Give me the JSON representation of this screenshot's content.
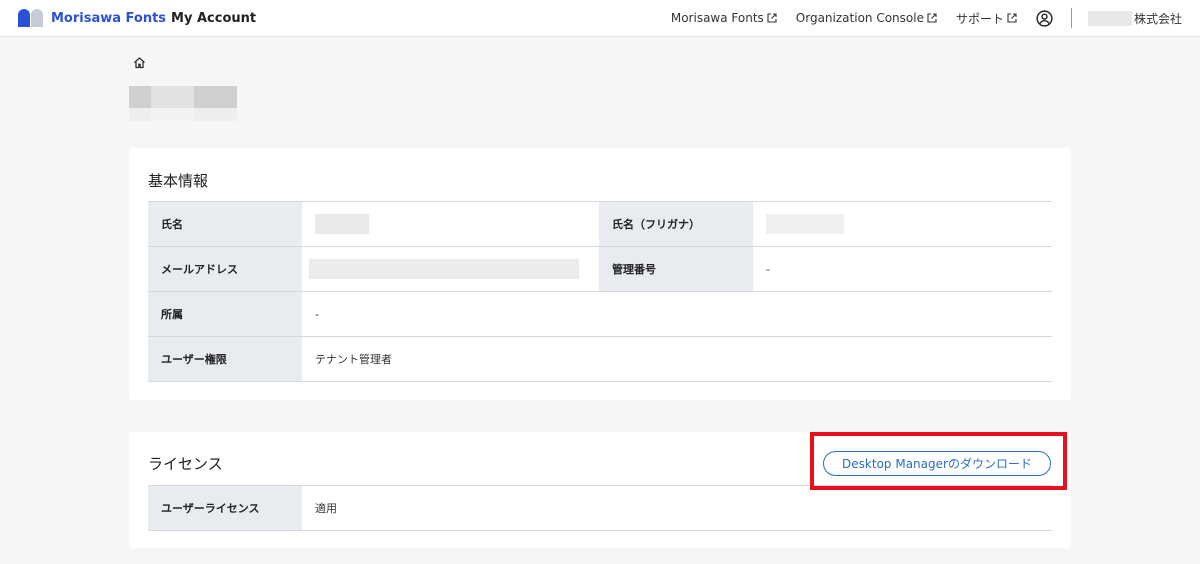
{
  "header": {
    "brand": "Morisawa Fonts",
    "brand_suffix": "My Account",
    "nav": [
      {
        "label": "Morisawa Fonts",
        "icon": "external-link-icon"
      },
      {
        "label": "Organization Console",
        "icon": "external-link-icon"
      },
      {
        "label": "サポート",
        "icon": "external-link-icon"
      }
    ],
    "org_name_suffix": "株式会社"
  },
  "basic_info": {
    "title": "基本情報",
    "name_label": "氏名",
    "furigana_label": "氏名（フリガナ）",
    "email_label": "メールアドレス",
    "mgmt_label": "管理番号",
    "mgmt_value": "-",
    "affiliation_label": "所属",
    "affiliation_value": "-",
    "role_label": "ユーザー権限",
    "role_value": "テナント管理者"
  },
  "license": {
    "title": "ライセンス",
    "download_button": "Desktop Managerのダウンロード",
    "user_license_label": "ユーザーライセンス",
    "user_license_value": "適用"
  },
  "colors": {
    "brand_blue": "#2b52d6",
    "link_blue": "#2a6fc0",
    "highlight_red": "#e8101a"
  }
}
